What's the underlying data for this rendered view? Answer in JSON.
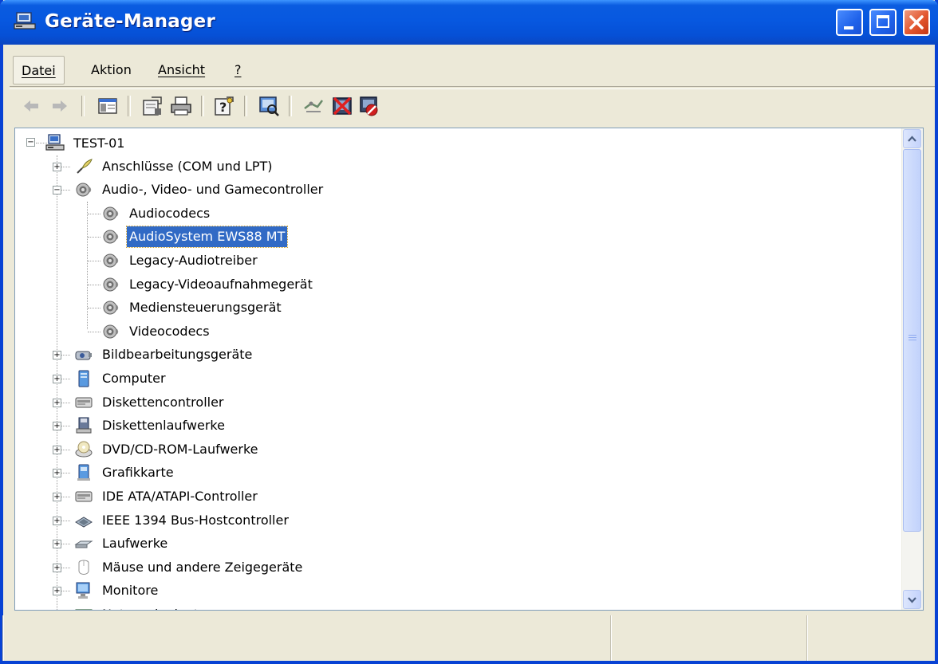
{
  "window": {
    "title": "Geräte-Manager",
    "icon": "device-manager-icon"
  },
  "menu": [
    {
      "label": "Datei",
      "accel": "D"
    },
    {
      "label": "Aktion",
      "accel": "t"
    },
    {
      "label": "Ansicht",
      "accel": "A"
    },
    {
      "label": "?",
      "accel": "?"
    }
  ],
  "toolbar": {
    "buttons": [
      "back-arrow-icon",
      "forward-arrow-icon",
      "show-hide-console-tree-icon",
      "properties-icon",
      "print-icon",
      "help-icon",
      "scan-hardware-icon",
      "update-driver-icon",
      "uninstall-icon",
      "disable-icon"
    ]
  },
  "tree": {
    "root": {
      "label": "TEST-01",
      "icon": "computer-icon"
    },
    "nodes": [
      {
        "label": "Anschlüsse (COM und LPT)",
        "icon": "port-icon",
        "expanded": false
      },
      {
        "label": "Audio-, Video- und Gamecontroller",
        "icon": "speaker-icon",
        "expanded": true,
        "children": [
          {
            "label": "Audiocodecs",
            "icon": "speaker-icon"
          },
          {
            "label": "AudioSystem EWS88 MT",
            "icon": "speaker-icon",
            "selected": true
          },
          {
            "label": "Legacy-Audiotreiber",
            "icon": "speaker-icon"
          },
          {
            "label": "Legacy-Videoaufnahmegerät",
            "icon": "speaker-icon"
          },
          {
            "label": "Mediensteuerungsgerät",
            "icon": "speaker-icon"
          },
          {
            "label": "Videocodecs",
            "icon": "speaker-icon"
          }
        ]
      },
      {
        "label": "Bildbearbeitungsgeräte",
        "icon": "camera-icon",
        "expanded": false
      },
      {
        "label": "Computer",
        "icon": "computer-node-icon",
        "expanded": false
      },
      {
        "label": "Diskettencontroller",
        "icon": "controller-icon",
        "expanded": false
      },
      {
        "label": "Diskettenlaufwerke",
        "icon": "floppy-icon",
        "expanded": false
      },
      {
        "label": "DVD/CD-ROM-Laufwerke",
        "icon": "cdrom-icon",
        "expanded": false
      },
      {
        "label": "Grafikkarte",
        "icon": "display-adapter-icon",
        "expanded": false
      },
      {
        "label": "IDE ATA/ATAPI-Controller",
        "icon": "controller-icon",
        "expanded": false
      },
      {
        "label": "IEEE 1394 Bus-Hostcontroller",
        "icon": "firewire-icon",
        "expanded": false
      },
      {
        "label": "Laufwerke",
        "icon": "drive-icon",
        "expanded": false
      },
      {
        "label": "Mäuse und andere Zeigegeräte",
        "icon": "mouse-icon",
        "expanded": false
      },
      {
        "label": "Monitore",
        "icon": "monitor-icon",
        "expanded": false
      },
      {
        "label": "Netzwerkadapter",
        "icon": "network-adapter-icon",
        "expanded": false
      }
    ]
  },
  "statusbar": {
    "panes": [
      "",
      "",
      ""
    ]
  },
  "colors": {
    "title_bar": "#0758e0",
    "selection": "#316ac5",
    "window_bg": "#ece9d8"
  }
}
